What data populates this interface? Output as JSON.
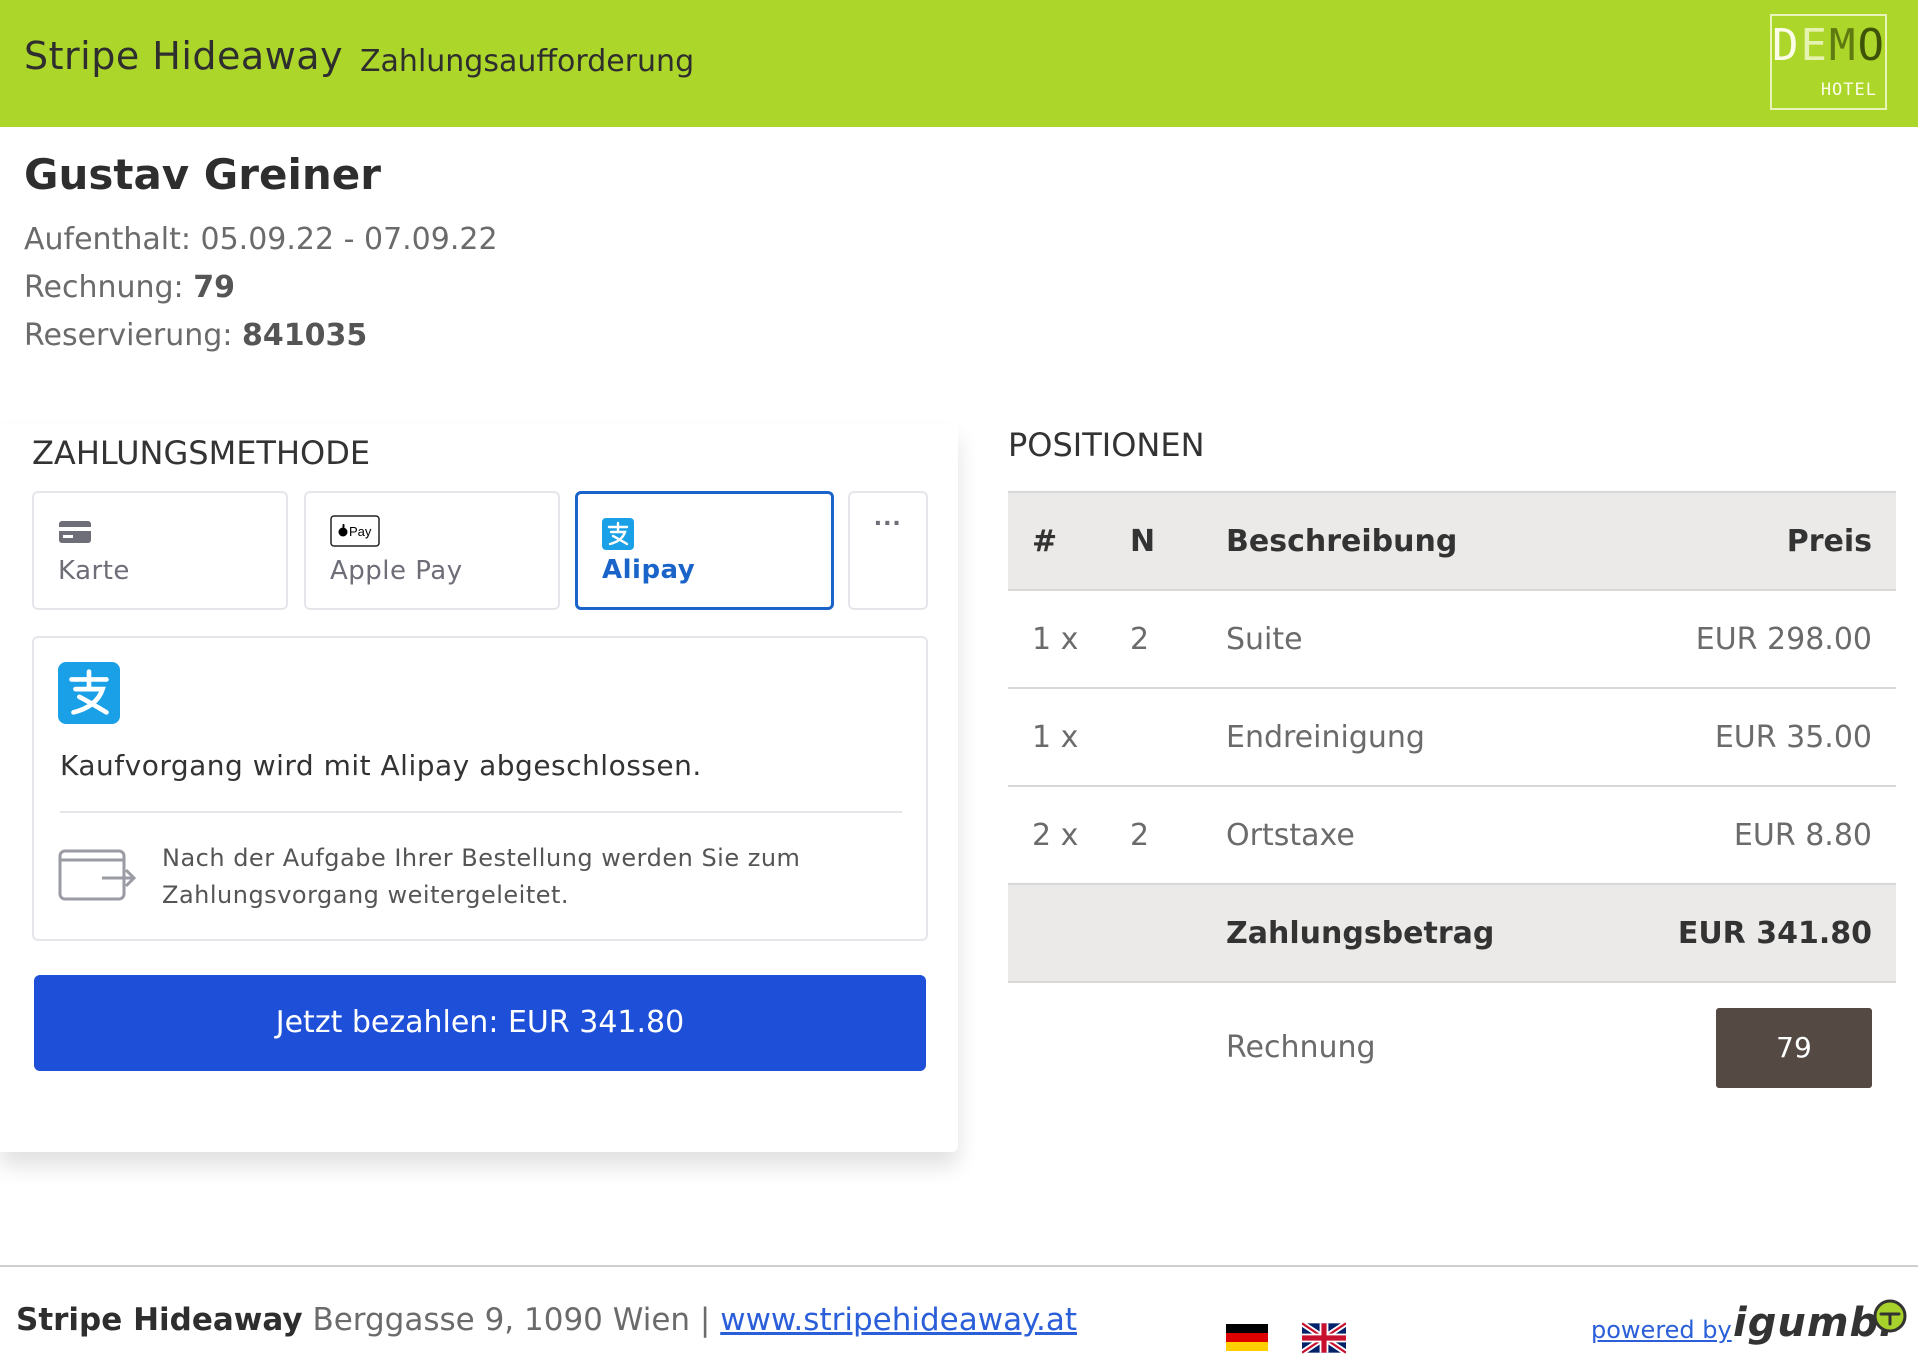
{
  "header": {
    "brand": "Stripe Hideaway",
    "subtitle": "Zahlungsaufforderung",
    "logo_demo": "DEMO",
    "logo_hotel": "HOTEL"
  },
  "guest": {
    "name": "Gustav Greiner",
    "stay_label": "Aufenthalt:",
    "stay_value": "05.09.22 - 07.09.22",
    "invoice_label": "Rechnung:",
    "invoice_value": "79",
    "reservation_label": "Reservierung:",
    "reservation_value": "841035"
  },
  "payment": {
    "title": "ZAHLUNGSMETHODE",
    "methods": [
      {
        "label": "Karte",
        "icon": "card-icon"
      },
      {
        "label": "Apple Pay",
        "icon": "apple-pay-icon",
        "icon_text": "Pay"
      },
      {
        "label": "Alipay",
        "icon": "alipay-icon",
        "selected": true
      }
    ],
    "more_label": "···",
    "info_text": "Kaufvorgang wird mit Alipay abgeschlossen.",
    "redirect_text": "Nach der Aufgabe Ihrer Bestellung werden Sie zum Zahlungsvorgang weitergeleitet.",
    "pay_button": "Jetzt bezahlen: EUR 341.80",
    "accent_color": "#1a64c9",
    "button_color": "#1d4fd8"
  },
  "positions": {
    "title": "POSITIONEN",
    "columns": [
      "#",
      "N",
      "Beschreibung",
      "Preis"
    ],
    "rows": [
      {
        "qty": "1 x",
        "n": "2",
        "desc": "Suite",
        "price": "EUR 298.00"
      },
      {
        "qty": "1 x",
        "n": "",
        "desc": "Endreinigung",
        "price": "EUR 35.00"
      },
      {
        "qty": "2 x",
        "n": "2",
        "desc": "Ortstaxe",
        "price": "EUR 8.80"
      }
    ],
    "total_label": "Zahlungsbetrag",
    "total_value": "EUR 341.80",
    "invoice_label": "Rechnung",
    "invoice_value": "79"
  },
  "footer": {
    "brand": "Stripe Hideaway",
    "address": "Berggasse 9, 1090 Wien |",
    "website": "www.stripehideaway.at",
    "powered_by": "powered by",
    "powered_logo": "igumbi",
    "languages": [
      "de-flag-icon",
      "uk-flag-icon"
    ]
  },
  "colors": {
    "header_bg": "#add62a",
    "badge_bg": "#554944",
    "table_header_bg": "#eceae8"
  }
}
